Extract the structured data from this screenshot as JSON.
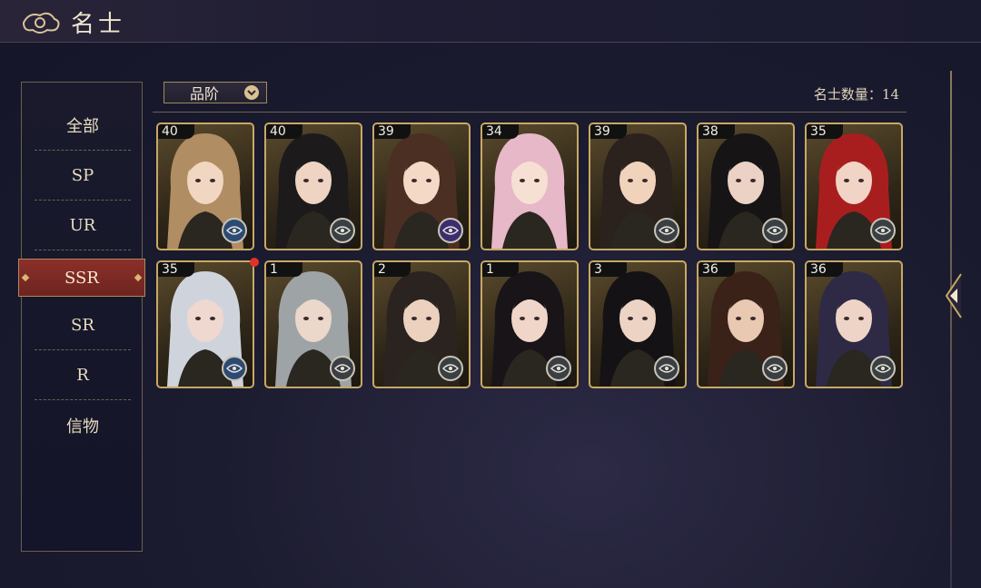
{
  "header": {
    "title": "名士"
  },
  "sidebar": {
    "items": [
      {
        "label": "全部"
      },
      {
        "label": "SP"
      },
      {
        "label": "UR"
      },
      {
        "label": "SSR"
      },
      {
        "label": "SR"
      },
      {
        "label": "R"
      },
      {
        "label": "信物"
      }
    ],
    "active": "SSR"
  },
  "filter": {
    "label": "品阶"
  },
  "count": {
    "text": "名士数量：14"
  },
  "cards": [
    {
      "level": "40",
      "badge": "blue-eye-icon",
      "hair": "#b08d62",
      "skin": "#f1d6c2"
    },
    {
      "level": "40",
      "badge": "gray-eye-icon",
      "hair": "#1d1a1c",
      "skin": "#efd3c3"
    },
    {
      "level": "39",
      "badge": "purple-eye-icon",
      "hair": "#4a2f22",
      "skin": "#f4d9c6"
    },
    {
      "level": "34",
      "badge": "none",
      "hair": "#e7b8c8",
      "skin": "#f6dfd3"
    },
    {
      "level": "39",
      "badge": "gray-eye-icon",
      "hair": "#2b211d",
      "skin": "#f1d3bc"
    },
    {
      "level": "38",
      "badge": "gray-eye-icon",
      "hair": "#171416",
      "skin": "#ecd2c4"
    },
    {
      "level": "35",
      "badge": "gray-eye-icon",
      "hair": "#a81e1e",
      "skin": "#f1d4c6"
    },
    {
      "level": "35",
      "badge": "blue-eye-icon",
      "hair": "#cfd4dc",
      "skin": "#efd8cf"
    },
    {
      "level": "1",
      "badge": "gray-eye-icon",
      "hair": "#9ea3a6",
      "skin": "#ecd7cb"
    },
    {
      "level": "2",
      "badge": "gray-eye-icon",
      "hair": "#2a2320",
      "skin": "#ecd1bf"
    },
    {
      "level": "1",
      "badge": "gray-eye-icon",
      "hair": "#181418",
      "skin": "#efd6c8"
    },
    {
      "level": "3",
      "badge": "gray-eye-icon",
      "hair": "#141214",
      "skin": "#ecd3c4"
    },
    {
      "level": "36",
      "badge": "gray-eye-icon",
      "hair": "#3a2218",
      "skin": "#e9c9b2"
    },
    {
      "level": "36",
      "badge": "gray-eye-icon",
      "hair": "#2e2a45",
      "skin": "#eed4c6"
    }
  ],
  "colors": {
    "accent": "#c8a964",
    "active_tab": "#8c2f2a",
    "notify": "#e0322c"
  }
}
